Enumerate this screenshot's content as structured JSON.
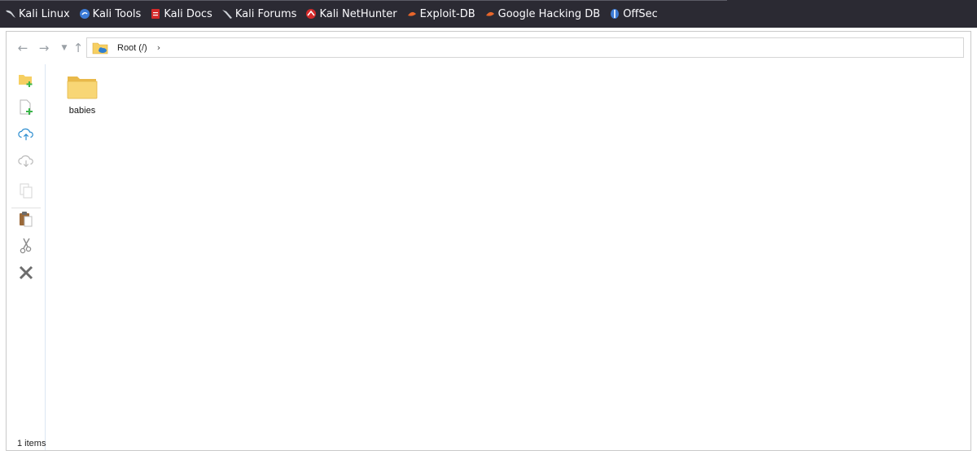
{
  "bookmarks": [
    {
      "label": "Kali Linux",
      "icon": "kali-dragon-icon",
      "color": "#cfd3d9"
    },
    {
      "label": "Kali Tools",
      "icon": "kali-tools-icon",
      "color": "#3c7bd6"
    },
    {
      "label": "Kali Docs",
      "icon": "kali-docs-icon",
      "color": "#d42a2a"
    },
    {
      "label": "Kali Forums",
      "icon": "kali-forums-icon",
      "color": "#cfd3d9"
    },
    {
      "label": "Kali NetHunter",
      "icon": "nethunter-icon",
      "color": "#d42a2a"
    },
    {
      "label": "Exploit-DB",
      "icon": "exploit-db-icon",
      "color": "#e8662b"
    },
    {
      "label": "Google Hacking DB",
      "icon": "ghdb-icon",
      "color": "#e8662b"
    },
    {
      "label": "OffSec",
      "icon": "offsec-icon",
      "color": "#3c7bd6"
    }
  ],
  "address": {
    "crumb": "Root (/)"
  },
  "files": [
    {
      "name": "babies",
      "type": "folder"
    }
  ],
  "status": {
    "text": "1 items"
  },
  "colors": {
    "folder": "#f6cf62",
    "accent_green": "#3bb54a",
    "bookmarks_bg": "#2b2a33"
  }
}
